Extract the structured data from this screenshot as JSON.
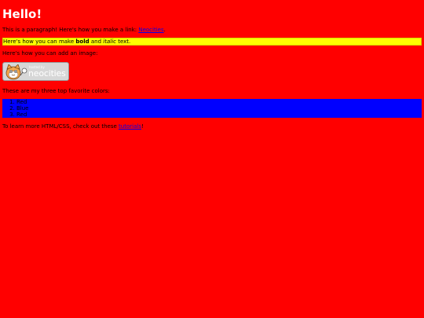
{
  "heading": "Hello!",
  "para1": {
    "text": "This is a paragraph! Here's how you make a link: ",
    "link": "Neocities",
    "end": "."
  },
  "para2": {
    "before": "Here's how you can make ",
    "bold": "bold",
    "middle": " and ",
    "italic": "italic",
    "after": " text."
  },
  "para3": "Here's how you can add an image:",
  "badge": {
    "top": "hosted by",
    "brand": "neocities"
  },
  "para4": "These are my three top favorite colors:",
  "colors": [
    "Red",
    "Blue",
    "Red"
  ],
  "para5": {
    "text": "To learn more HTML/CSS, check out these ",
    "link": "tutorials",
    "end": "!"
  },
  "theme": {
    "background": "#ff0000",
    "highlight": "#ffff00",
    "list_background": "#0000ff",
    "heading_color": "#ffffff",
    "link_color": "#0000ee"
  }
}
